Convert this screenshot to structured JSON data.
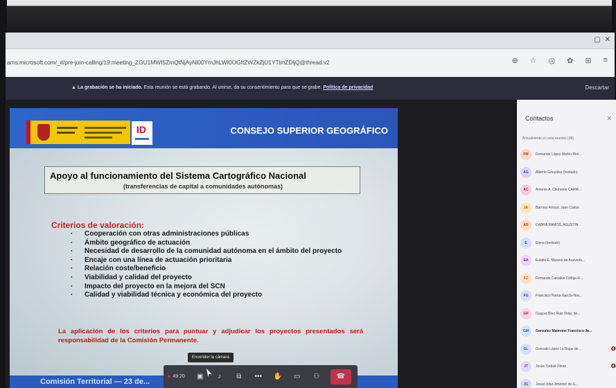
{
  "browser": {
    "url": "ams.microsoft.com/_#/pre-join-calling/19:meeting_ZGU1MWI5ZmQtNjAyNi00YmJhLWI0OGItZWZkZjU1YTlmZDljQ@thread.v2",
    "window_controls": [
      "▢",
      "✕"
    ],
    "address_icons": [
      "⊕",
      "☆",
      "◎",
      "✿",
      "⊞",
      "≡"
    ]
  },
  "banner": {
    "bold": "La grabación se ha iniciado.",
    "text": " Esta reunión se está grabando. Al unirse, da su consentimiento para que se grabe. ",
    "link": "Política de privacidad",
    "close": "Descartar"
  },
  "slide": {
    "org": "CONSEJO SUPERIOR GEOGRÁFICO",
    "title": "Apoyo al funcionamiento del Sistema Cartográfico Nacional",
    "subtitle": "(transferencias de capital a comunidades autónomas)",
    "criteria_heading": "Criterios de valoración:",
    "criteria": [
      "Cooperación con otras administraciones públicas",
      "Ámbito geográfico de actuación",
      "Necesidad de desarrollo de la comunidad autónoma en el ámbito del proyecto",
      "Encaje con una línea de actuación prioritaria",
      "Relación coste/beneficio",
      "Viabilidad y calidad del proyecto",
      "Impacto del proyecto en la mejora del SCN",
      "Calidad y viabilidad técnica y económica del proyecto"
    ],
    "footer_note": "La aplicación de los criterios para puntuar y adjudicar los proyectos presentados será responsabilidad de la Comisión Permanente.",
    "bottom_text": "Comisión Territorial — 23 de..."
  },
  "toolbar": {
    "tooltip": "Encender la cámara",
    "timer": "49:20",
    "items": [
      {
        "name": "camera-button",
        "icon": "▣"
      },
      {
        "name": "mic-button",
        "icon": "♪"
      },
      {
        "name": "share-button",
        "icon": "⧉"
      },
      {
        "name": "more-button",
        "icon": "•••"
      },
      {
        "name": "raise-hand-button",
        "icon": "✋"
      },
      {
        "name": "chat-button",
        "icon": "▭"
      },
      {
        "name": "participants-button",
        "icon": "⚇"
      }
    ],
    "hangup_icon": "☎"
  },
  "panel": {
    "title": "Contactos",
    "close": "✕",
    "subtitle": "Actualmente en esta reunión (39)",
    "contacts": [
      {
        "initials": "FM",
        "name": "Fernando López Martín-Rivi...",
        "color": "#f7d6cc",
        "text": "#a33a1a",
        "bold": false,
        "mic": ""
      },
      {
        "initials": "AG",
        "name": "Alberto González (Invitado)",
        "color": "#d9d6f0",
        "text": "#4a3fa0",
        "bold": false,
        "mic": ""
      },
      {
        "initials": "AC",
        "name": "Antonio A. Clemente CARM...",
        "color": "#f0d0dc",
        "text": "#a02050",
        "bold": false,
        "mic": ""
      },
      {
        "initials": "JA",
        "name": "Barroso Arroyo, Juan Carlos",
        "color": "#fbe3c0",
        "text": "#a86010",
        "bold": false,
        "mic": ""
      },
      {
        "initials": "AR",
        "name": "CABRA RAMOS, AGUSTIN",
        "color": "#f8dcc4",
        "text": "#a04a10",
        "bold": false,
        "mic": ""
      },
      {
        "initials": "E",
        "name": "Elena (Invitado)",
        "color": "#d6defa",
        "text": "#3048a8",
        "bold": false,
        "mic": ""
      },
      {
        "initials": "EA",
        "name": "Eulalia E. Moreno de Acevedo...",
        "color": "#ead6f4",
        "text": "#7a2aa0",
        "bold": false,
        "mic": ""
      },
      {
        "initials": "FZ",
        "name": "Fernando Caballos Zúñiga R...",
        "color": "#fbe0c8",
        "text": "#a85a10",
        "bold": false,
        "mic": ""
      },
      {
        "initials": "FG",
        "name": "Francisco Rama García-Nov...",
        "color": "#dcdcf2",
        "text": "#4040a0",
        "bold": false,
        "mic": ""
      },
      {
        "initials": "GR",
        "name": "Gaspar Díez Ruiz Vidal, de...",
        "color": "#f4d6e4",
        "text": "#a02868",
        "bold": false,
        "mic": ""
      },
      {
        "initials": "GM",
        "name": "Gonzalez Maimone Francisco Ja...",
        "color": "#d6e2f6",
        "text": "#2a54a0",
        "bold": true,
        "mic": ""
      },
      {
        "initials": "GL",
        "name": "Gonzalo López Lo Bojas de...",
        "color": "#d8e0f4",
        "text": "#344ea0",
        "bold": false,
        "mic": "🔇"
      },
      {
        "initials": "JT",
        "name": "Jesús Turbuk Pérez",
        "color": "#e2dcf2",
        "text": "#5a3aa0",
        "bold": false,
        "mic": "🔇"
      },
      {
        "initials": "JG",
        "name": "Jesús Joba Jiménez de G...",
        "color": "#d6dcf0",
        "text": "#3a48a0",
        "bold": false,
        "mic": ""
      }
    ]
  }
}
